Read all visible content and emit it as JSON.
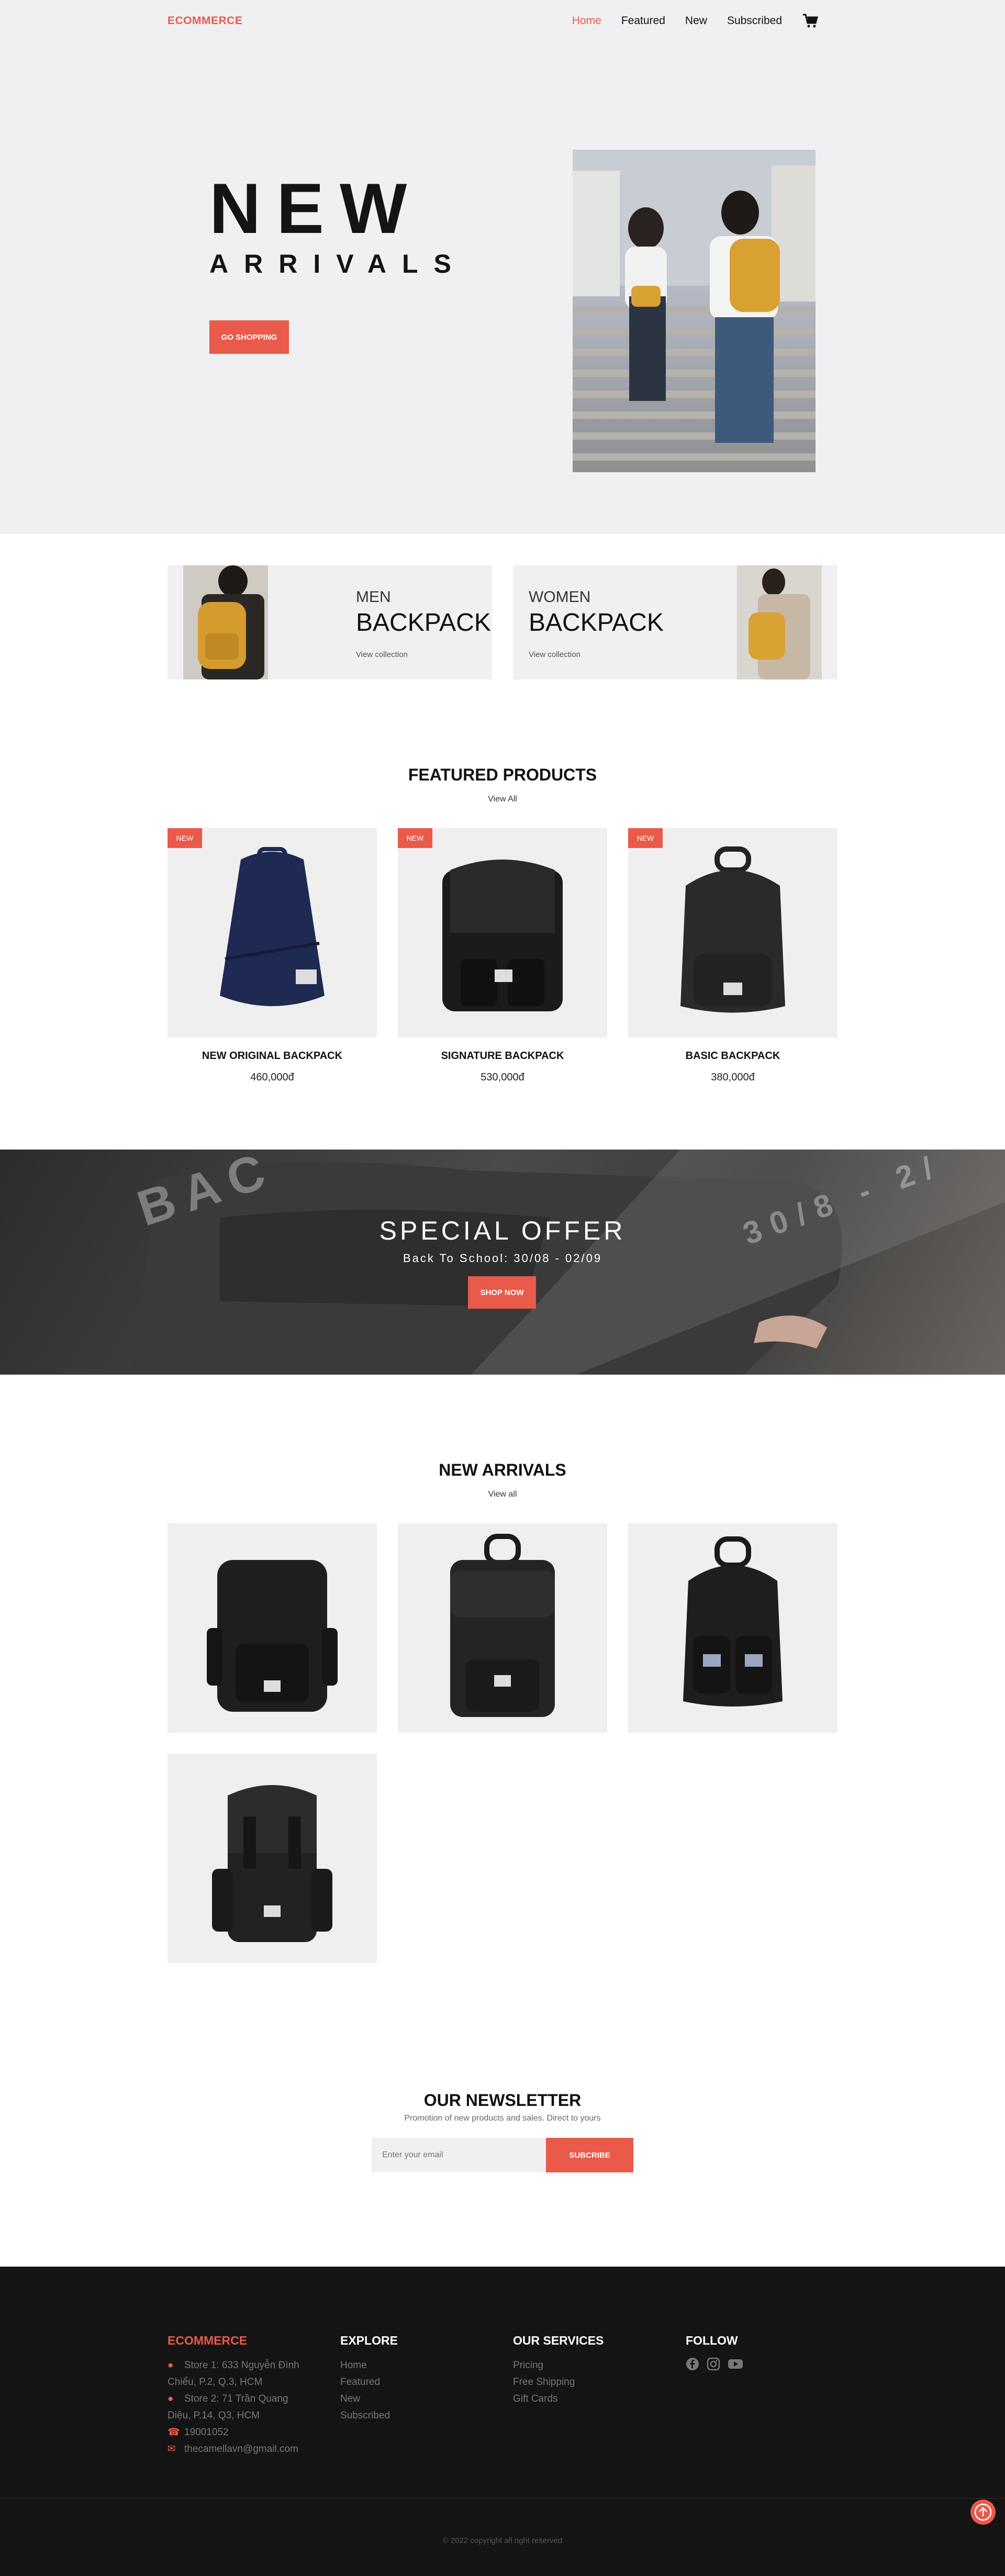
{
  "nav": {
    "brand": "ECOMMERCE",
    "items": [
      "Home",
      "Featured",
      "New",
      "Subscribed"
    ],
    "cart_icon": "cart-icon"
  },
  "hero": {
    "title": "NEW",
    "subtitle": "ARRIVALS",
    "button": "GO SHOPPING"
  },
  "categories": [
    {
      "small": "MEN",
      "big": "BACKPACK",
      "link": "View collection"
    },
    {
      "small": "WOMEN",
      "big": "BACKPACK",
      "link": "View collection"
    }
  ],
  "featured": {
    "title": "FEATURED PRODUCTS",
    "link": "View All",
    "products": [
      {
        "badge": "NEW",
        "name": "NEW ORIGINAL BACKPACK",
        "price": "460,000đ",
        "color": "#1f2a52"
      },
      {
        "badge": "NEW",
        "name": "SIGNATURE BACKPACK",
        "price": "530,000đ",
        "color": "#1b1b1b"
      },
      {
        "badge": "NEW",
        "name": "BASIC BACKPACK",
        "price": "380,000đ",
        "color": "#2a2a2a"
      }
    ]
  },
  "offer": {
    "title": "SPECIAL OFFER",
    "subtitle": "Back To School: 30/08 - 02/09",
    "button": "SHOP NOW",
    "deco_left": "BAC",
    "deco_right": "30/8 - 2/"
  },
  "arrivals": {
    "title": "NEW ARRIVALS",
    "link": "View all"
  },
  "newsletter": {
    "title": "OUR NEWSLETTER",
    "subtitle": "Promotion of new products and sales. Direct to yours",
    "placeholder": "Enter your email",
    "button": "SUBCRIBE"
  },
  "footer": {
    "brand": "ECOMMERCE",
    "contacts": [
      {
        "icon": "location-icon",
        "text": "Store 1: 633 Nguyễn Đình"
      },
      {
        "icon": "",
        "text": "Chiểu, P.2, Q.3, HCM"
      },
      {
        "icon": "location-icon",
        "text": "Store 2: 71 Trần Quang"
      },
      {
        "icon": "",
        "text": "Diệu, P.14, Q3, HCM"
      },
      {
        "icon": "phone-icon",
        "text": "19001052"
      },
      {
        "icon": "mail-icon",
        "text": "thecamellavn@gmail.com"
      }
    ],
    "explore_title": "EXPLORE",
    "explore": [
      "Home",
      "Featured",
      "New",
      "Subscribed"
    ],
    "services_title": "OUR SERVICES",
    "services": [
      "Pricing",
      "Free Shipping",
      "Gift Cards"
    ],
    "follow_title": "FOLLOW",
    "social": [
      "facebook-icon",
      "instagram-icon",
      "youtube-icon"
    ],
    "copyright": "© 2022 copyright all right reserved"
  },
  "colors": {
    "accent": "#e95a4a",
    "footer_bg": "#141414",
    "hero_bg": "#f0f0f2"
  }
}
